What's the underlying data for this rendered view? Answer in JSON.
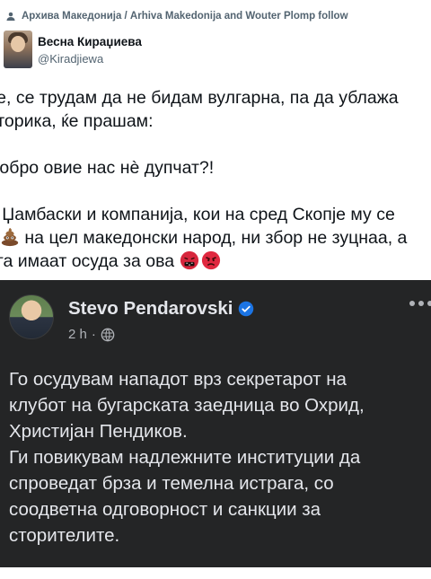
{
  "social_context": {
    "icon": "person-icon",
    "text": "Архива Македонија / Arhiva Makedonija and Wouter Plomp follow"
  },
  "author": {
    "name": "Весна Кираџиева",
    "handle": "@Kiradjiewa"
  },
  "tweet": {
    "line1": "ве, се трудам да не бидам вулгарна, па да ублажа",
    "line2": "еторика, ќе прашам:",
    "line3": "Добро овие нас нè дупчат?!",
    "line4": "а Џамбаски и компанија, кои на сред Скопје му се",
    "line5": " на цел македонски народ, ни збор не зуцнаа, а",
    "line6": "ега имаат осуда за ова ",
    "emojis": [
      "pile-of-poo-icon",
      "cursing-face-icon",
      "angry-face-icon"
    ]
  },
  "fb_post": {
    "author_name": "Stevo Pendarovski",
    "verified_icon": "verified-badge-icon",
    "time": "2 h",
    "audience_icon": "globe-icon",
    "more_icon": "more-options-icon",
    "text": [
      "Го осудувам нападот врз секретарот на",
      "клубот на бугарската заедница во Охрид,",
      "Христијан Пендиков.",
      "Ги повикувам надлежните институции да",
      "спроведат брза и темелна истрага, со",
      "соодветна одговорност и санкции за",
      "сторителите."
    ]
  },
  "colors": {
    "text_primary": "#0f1419",
    "text_secondary": "#536471",
    "fb_background": "#242526",
    "fb_text": "#e4e6eb",
    "fb_meta": "#b0b3b8",
    "verified": "#1b74e4"
  }
}
